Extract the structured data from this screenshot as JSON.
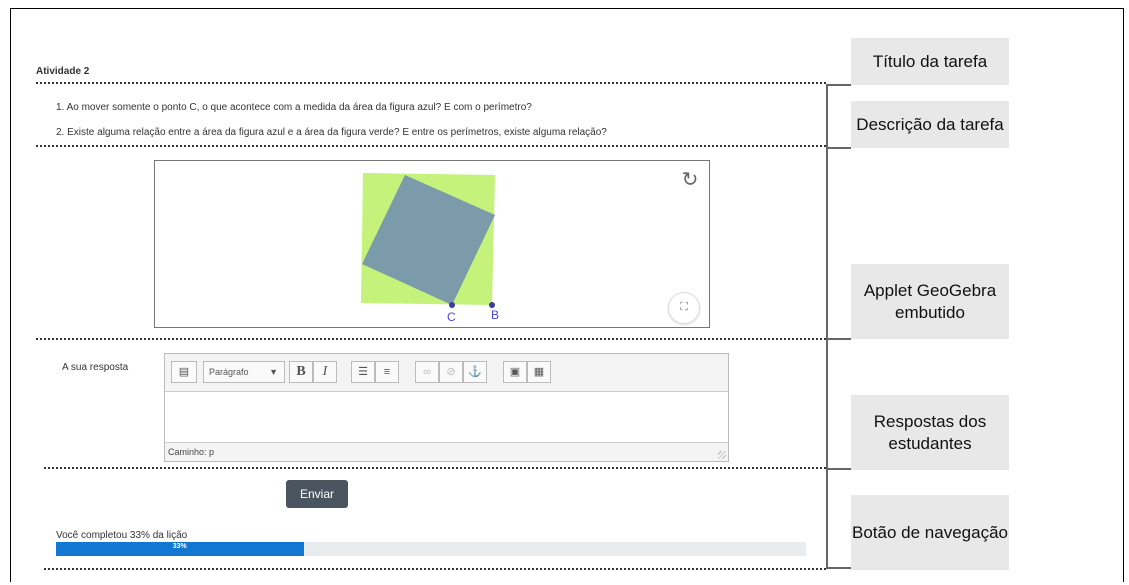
{
  "activity": {
    "title": "Atividade 2",
    "questions": [
      "1. Ao mover somente o ponto C, o que acontece com a medida da área da figura azul? E com o perímetro?",
      "2. Existe alguma relação entre a área da figura azul e a área da figura verde? E entre os perímetros, existe alguma relação?"
    ]
  },
  "applet": {
    "point_c_label": "C",
    "point_b_label": "B",
    "refresh_icon": "refresh-icon",
    "fullscreen_icon": "fullscreen-icon",
    "colors": {
      "green_square": "#c4f27a",
      "blue_square": "#7b9aaa",
      "points": "#3a3aa0"
    }
  },
  "answer": {
    "label": "A sua resposta",
    "toolbar": {
      "paragraph_select": "Parágrafo",
      "bold": "B",
      "italic": "I"
    },
    "path_label": "Caminho: p"
  },
  "submit_button": "Enviar",
  "progress": {
    "label": "Você completou 33% da lição",
    "bar_text": "33%",
    "value": 0.33,
    "color": "#1177d1"
  },
  "annotations": [
    {
      "text": "Título da tarefa"
    },
    {
      "text": "Descrição da tarefa"
    },
    {
      "text": "Applet GeoGebra embutido"
    },
    {
      "text": "Respostas dos estudantes"
    },
    {
      "text": "Botão de navegação"
    }
  ]
}
